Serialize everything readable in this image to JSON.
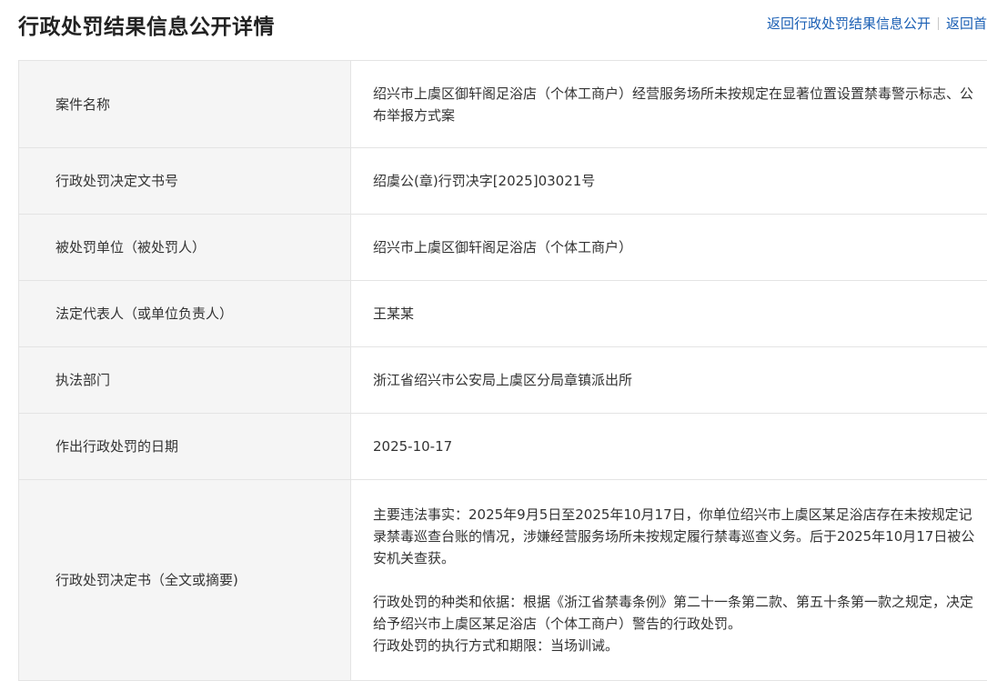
{
  "page": {
    "title": "行政处罚结果信息公开详情"
  },
  "nav": {
    "back_list_label": "返回行政处罚结果信息公开",
    "back_home_label": "返回首"
  },
  "rows": [
    {
      "label": "案件名称",
      "value": "绍兴市上虞区御轩阁足浴店（个体工商户）经营服务场所未按规定在显著位置设置禁毒警示标志、公布举报方式案"
    },
    {
      "label": "行政处罚决定文书号",
      "value": "绍虞公(章)行罚决字[2025]03021号"
    },
    {
      "label": "被处罚单位（被处罚人）",
      "value": "绍兴市上虞区御轩阁足浴店（个体工商户）"
    },
    {
      "label": "法定代表人（或单位负责人）",
      "value": "王某某"
    },
    {
      "label": "执法部门",
      "value": "浙江省绍兴市公安局上虞区分局章镇派出所"
    },
    {
      "label": "作出行政处罚的日期",
      "value": "2025-10-17"
    },
    {
      "label": "行政处罚决定书（全文或摘要)",
      "paragraphs": [
        "主要违法事实：2025年9月5日至2025年10月17日，你单位绍兴市上虞区某足浴店存在未按规定记录禁毒巡查台账的情况，涉嫌经营服务场所未按规定履行禁毒巡查义务。后于2025年10月17日被公安机关查获。",
        "行政处罚的种类和依据：根据《浙江省禁毒条例》第二十一条第二款、第五十条第一款之规定，决定给予绍兴市上虞区某足浴店（个体工商户）警告的行政处罚。",
        "行政处罚的执行方式和期限：当场训诫。"
      ]
    }
  ]
}
